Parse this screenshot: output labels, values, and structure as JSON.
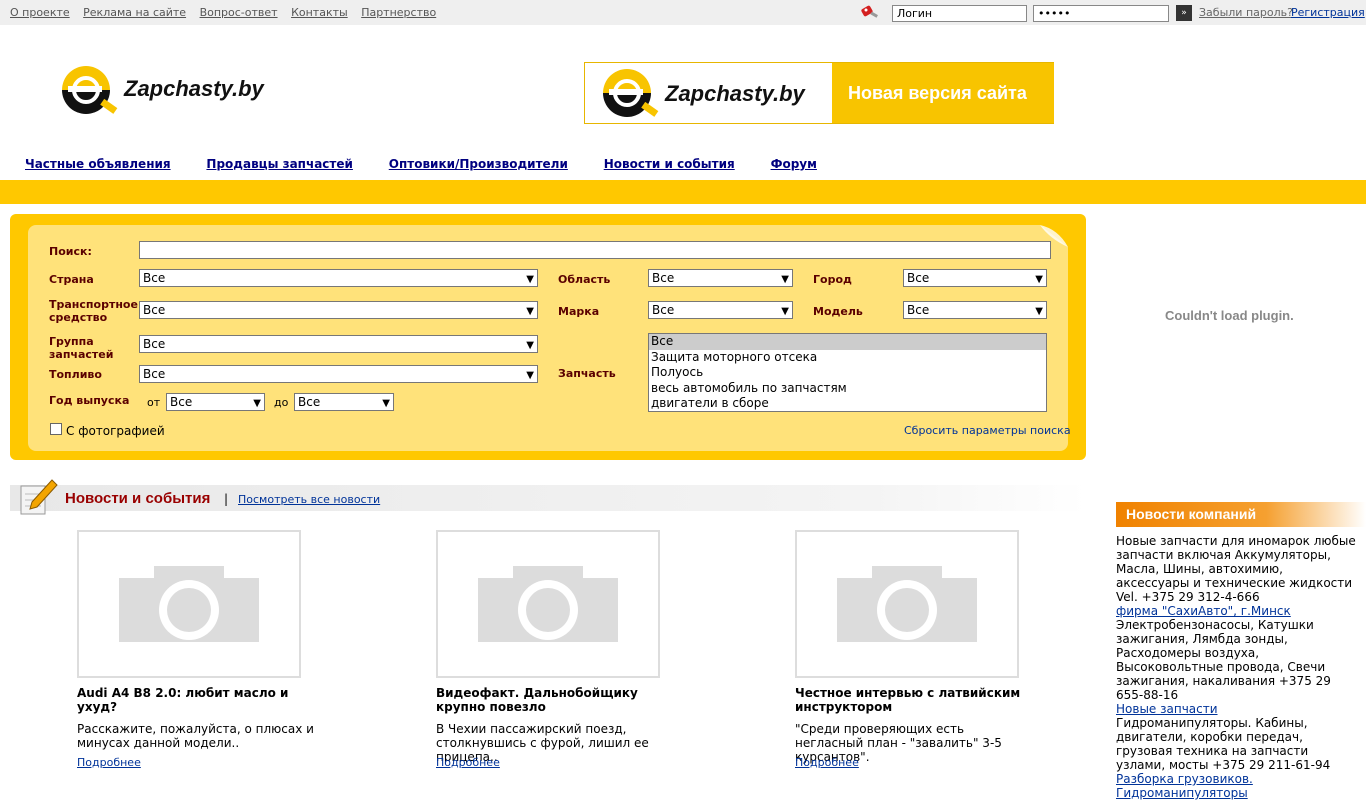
{
  "topbar": {
    "links": [
      "О проекте",
      "Реклама на сайте",
      "Вопрос-ответ",
      "Контакты",
      "Партнерство"
    ],
    "login_value": "Логин",
    "password_value": "•••••",
    "go_icon": "»",
    "forgot": "Забыли пароль?",
    "register": "Регистрация"
  },
  "logo": {
    "text": "Zapchasty.by"
  },
  "banner": {
    "logo_text": "Zapchasty.by",
    "slogan": "Новая версия сайта"
  },
  "nav": [
    "Частные объявления",
    "Продавцы запчастей",
    "Оптовики/Производители",
    "Новости и события",
    "Форум"
  ],
  "search": {
    "search_label": "Поиск:",
    "country_label": "Страна",
    "country_value": "Все",
    "region_label": "Область",
    "region_value": "Все",
    "city_label": "Город",
    "city_value": "Все",
    "vehicle_label_1": "Транспортное",
    "vehicle_label_2": "средство",
    "vehicle_value": "Все",
    "brand_label": "Марка",
    "brand_value": "Все",
    "model_label": "Модель",
    "model_value": "Все",
    "group_label_1": "Группа",
    "group_label_2": "запчастей",
    "group_value": "Все",
    "fuel_label": "Топливо",
    "fuel_value": "Все",
    "part_label": "Запчасть",
    "parts": [
      "Все",
      "Защита моторного отсека",
      "Полуось",
      "весь автомобиль по запчастям",
      "двигатели в сборе"
    ],
    "year_label": "Год выпуска",
    "from_label": "от",
    "from_value": "Все",
    "to_label": "до",
    "to_value": "Все",
    "photo_label": "С фотографией",
    "reset": "Сбросить параметры поиска"
  },
  "news": {
    "title": "Новости и события",
    "separator": "|",
    "all_link": "Посмотреть все новости",
    "items": [
      {
        "title": "Audi A4 B8 2.0: любит масло и ухуд?",
        "desc": "Расскажите, пожалуйста, о плюсах и минусах данной модели..",
        "more": "Подробнее"
      },
      {
        "title": "Видеофакт. Дальнобойщику крупно повезло",
        "desc": "В Чехии пассажирский поезд, столкнувшись с фурой, лишил ее прицепа..",
        "more": "Подробнее"
      },
      {
        "title": "Честное интервью с латвийским инструктором",
        "desc": "\"Среди проверяющих есть негласный план - \"завалить\" 3-5 курсантов\".",
        "more": "Подробнее"
      }
    ]
  },
  "plugin_msg": "Couldn't load plugin.",
  "company_news": {
    "title": "Новости компаний",
    "text1": "Новые запчасти для иномарок любые запчасти включая Аккумуляторы, Масла, Шины, автохимию, аксессуары и технические жидкости Vel. +375 29 312-4-666",
    "link1": "фирма \"СахиАвто\", г.Минск",
    "text2": "Электробензонасосы, Катушки зажигания, Лямбда зонды, Расходомеры воздуха, Высоковольтные провода, Свечи зажигания, накаливания +375 29 655-88-16",
    "link2": "Новые запчасти",
    "text3": "Гидроманипуляторы. Кабины, двигатели, коробки передач, грузовая техника на запчасти узлами, мосты +375 29 211-61-94",
    "link3": "Разборка грузовиков. Гидроманипуляторы"
  },
  "colors": {
    "brand_yellow": "#ffc800",
    "panel_yellow": "#ffe27a",
    "news_red": "#990000",
    "orange": "#f08200"
  }
}
